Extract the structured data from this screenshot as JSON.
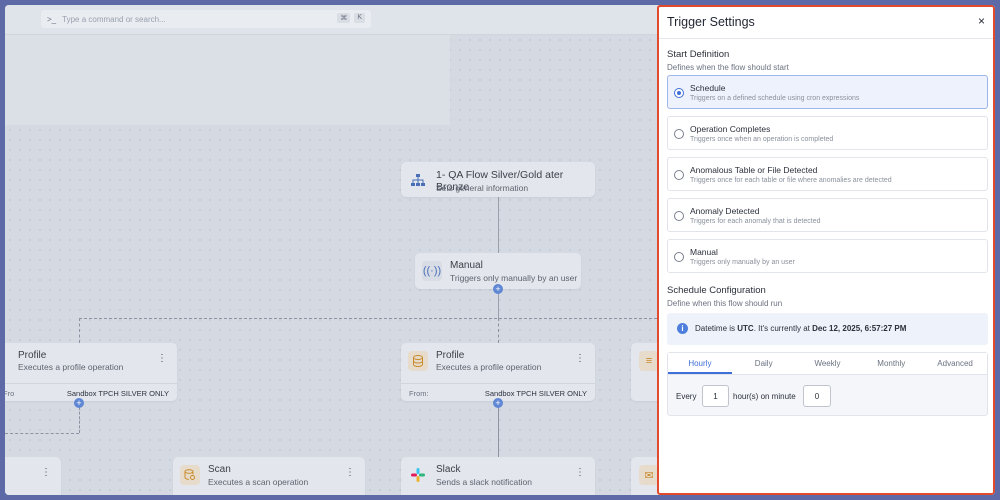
{
  "command_bar": {
    "placeholder": "Type a command or search...",
    "shortcut_mod": "⌘",
    "shortcut_key": "K"
  },
  "canvas": {
    "root_node": {
      "title": "1- QA Flow Silver/Gold ater Bronze",
      "subtitle": "Sets general information"
    },
    "trigger_node": {
      "title": "Manual",
      "subtitle": "Triggers only manually by an user"
    },
    "profile_left": {
      "title": "Profile",
      "subtitle": "Executes a profile operation",
      "from": "Fro",
      "source": "Sandbox TPCH SILVER ONLY"
    },
    "profile_center": {
      "title": "Profile",
      "subtitle": "Executes a profile operation",
      "from": "From:",
      "source": "Sandbox TPCH SILVER ONLY"
    },
    "scan_node": {
      "title": "Scan",
      "subtitle": "Executes a scan operation"
    },
    "slack_node": {
      "title": "Slack",
      "subtitle": "Sends a slack notification"
    },
    "plus_label": "+"
  },
  "panel": {
    "title": "Trigger Settings",
    "close_label": "×",
    "start_definition": {
      "title": "Start Definition",
      "subtitle": "Defines when the flow should start",
      "options": [
        {
          "label": "Schedule",
          "desc": "Triggers on a defined schedule using cron expressions",
          "selected": true
        },
        {
          "label": "Operation Completes",
          "desc": "Triggers once when an operation is completed",
          "selected": false
        },
        {
          "label": "Anomalous Table or File Detected",
          "desc": "Triggers once for each table or file where anomalies are detected",
          "selected": false
        },
        {
          "label": "Anomaly Detected",
          "desc": "Triggers for each anomaly that is detected",
          "selected": false
        },
        {
          "label": "Manual",
          "desc": "Triggers only manually by an user",
          "selected": false
        }
      ]
    },
    "schedule_config": {
      "title": "Schedule Configuration",
      "subtitle": "Define when this flow should run",
      "info_prefix": "Datetime is ",
      "info_tz": "UTC",
      "info_middle": ". It's currently at ",
      "info_datetime": "Dec 12, 2025, 6:57:27 PM",
      "tabs": [
        "Hourly",
        "Daily",
        "Weekly",
        "Monthly",
        "Advanced"
      ],
      "active_tab": "Hourly",
      "every_label": "Every",
      "hours_value": "1",
      "hours_suffix": "hour(s) on minute",
      "minute_value": "0"
    }
  },
  "colors": {
    "accent": "#3f6fd8",
    "highlight_border": "#e24a2d",
    "canvas_bg": "#d5dae2",
    "frame_bg": "#5d6aa7"
  }
}
